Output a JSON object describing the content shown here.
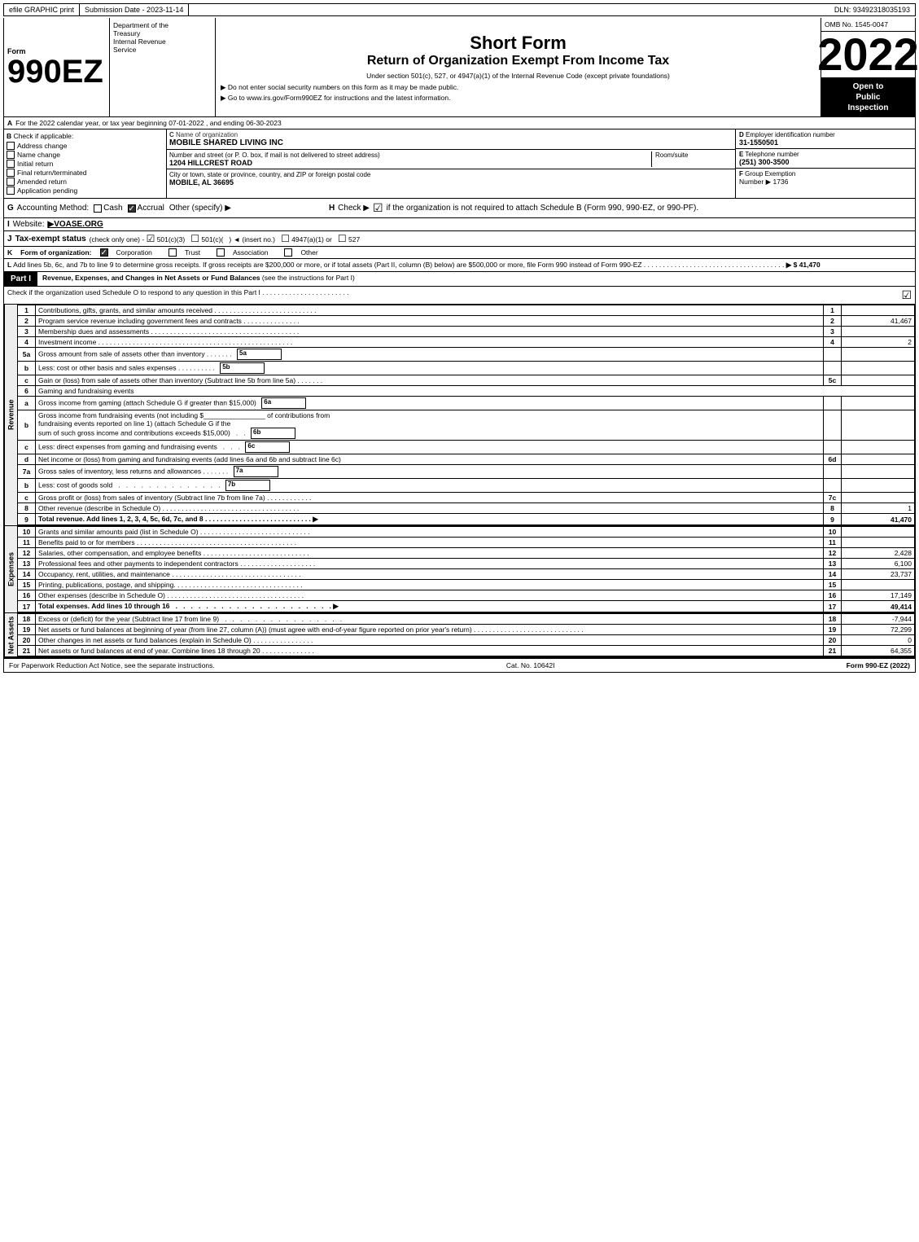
{
  "topBar": {
    "efile": "efile GRAPHIC print",
    "submissionLabel": "Submission Date - 2023-11-14",
    "dln": "DLN: 93492318035193"
  },
  "header": {
    "ombLabel": "OMB No. 1545-0047",
    "formNumber": "990EZ",
    "formDept1": "Department of the",
    "formDept2": "Treasury",
    "formDept3": "Internal Revenue",
    "formDept4": "Service",
    "shortForm": "Short Form",
    "returnTitle": "Return of Organization Exempt From Income Tax",
    "subtitle": "Under section 501(c), 527, or 4947(a)(1) of the Internal Revenue Code (except private foundations)",
    "inst1": "▶ Do not enter social security numbers on this form as it may be made public.",
    "inst2": "▶ Go to www.irs.gov/Form990EZ for instructions and the latest information.",
    "year": "2022",
    "openToPublic": "Open to\nPublic\nInspection"
  },
  "sectionA": {
    "label": "A",
    "text": "For the 2022 calendar year, or tax year beginning 07-01-2022 , and ending 06-30-2023"
  },
  "sectionB": {
    "label": "B",
    "title": "Check if applicable:",
    "options": [
      {
        "id": "address-change",
        "label": "Address change",
        "checked": false
      },
      {
        "id": "name-change",
        "label": "Name change",
        "checked": false
      },
      {
        "id": "initial-return",
        "label": "Initial return",
        "checked": false
      },
      {
        "id": "final-return",
        "label": "Final return/terminated",
        "checked": false
      },
      {
        "id": "amended-return",
        "label": "Amended return",
        "checked": false
      },
      {
        "id": "application-pending",
        "label": "Application pending",
        "checked": false
      }
    ]
  },
  "sectionC": {
    "label": "C",
    "title": "Name of organization",
    "orgName": "MOBILE SHARED LIVING INC",
    "addressLabel": "Number and street (or P. O. box, if mail is not delivered to street address)",
    "address": "1204 HILLCREST ROAD",
    "roomSuiteLabel": "Room/suite",
    "roomSuite": "",
    "cityLabel": "City or town, state or province, country, and ZIP or foreign postal code",
    "city": "MOBILE, AL  36695"
  },
  "sectionD": {
    "label": "D",
    "title": "Employer identification number",
    "ein": "31-1550501"
  },
  "sectionE": {
    "label": "E",
    "title": "Telephone number",
    "phone": "(251) 300-3500"
  },
  "sectionF": {
    "label": "F",
    "title": "Group Exemption",
    "numberLabel": "Number",
    "number": "▶ 1736"
  },
  "sectionG": {
    "label": "G",
    "title": "Accounting Method:",
    "cash": "Cash",
    "accrual": "Accrual",
    "accrualChecked": true,
    "other": "Other (specify) ▶",
    "otherValue": ""
  },
  "sectionH": {
    "label": "H",
    "text": "Check ▶",
    "checkLabel": "☑",
    "desc": "if the organization is not required to attach Schedule B (Form 990, 990-EZ, or 990-PF)."
  },
  "sectionI": {
    "label": "I",
    "title": "Website:",
    "url": "▶VOASE.ORG"
  },
  "sectionJ": {
    "label": "J",
    "title": "Tax-exempt status",
    "text": "(check only one) - ☑ 501(c)(3)  ☐ 501(c)(   ) ◄ (insert no.)  ☐ 4947(a)(1) or  ☐ 527"
  },
  "sectionK": {
    "label": "K",
    "title": "Form of organization:",
    "options": [
      "Corporation",
      "Trust",
      "Association",
      "Other"
    ],
    "corpChecked": true
  },
  "sectionL": {
    "label": "L",
    "text": "Add lines 5b, 6c, and 7b to line 9 to determine gross receipts. If gross receipts are $200,000 or more, or if total assets (Part II, column (B) below) are $500,000 or more, file Form 990 instead of Form 990-EZ . . . . . . . . . . . . . . . . . . . . . . . . . . . . . . . . . . . .",
    "arrow": "▶",
    "value": "$ 41,470"
  },
  "partI": {
    "label": "Part I",
    "title": "Revenue, Expenses, and Changes in Net Assets or Fund Balances",
    "seeNote": "(see the instructions for Part I)",
    "checkNote": "Check if the organization used Schedule O to respond to any question in this Part I . . . . . . . . . . . . . . . . . . . . . . .",
    "checkValue": "☑",
    "lines": [
      {
        "num": "1",
        "desc": "Contributions, gifts, grants, and similar amounts received . . . . . . . . . . . . . . . . . . . . . . . . . . .",
        "ref": "",
        "value": ""
      },
      {
        "num": "2",
        "desc": "Program service revenue including government fees and contracts . . . . . . . . . . . . . . .",
        "ref": "",
        "value": "41,467"
      },
      {
        "num": "3",
        "desc": "Membership dues and assessments . . . . . . . . . . . . . . . . . . . . . . . . . . . . . . . . . . . . . . .",
        "ref": "",
        "value": ""
      },
      {
        "num": "4",
        "desc": "Investment income . . . . . . . . . . . . . . . . . . . . . . . . . . . . . . . . . . . . . . . . . . . . . . . . . . .",
        "ref": "",
        "value": "2"
      },
      {
        "num": "5a",
        "desc": "Gross amount from sale of assets other than inventory . . . . . . . .",
        "ref": "5a",
        "value": ""
      },
      {
        "num": "b",
        "desc": "Less: cost or other basis and sales expenses . . . . . . . . . . .",
        "ref": "5b",
        "value": ""
      },
      {
        "num": "c",
        "desc": "Gain or (loss) from sale of assets other than inventory (Subtract line 5b from line 5a) . . . . . . .",
        "ref": "5c",
        "value": ""
      },
      {
        "num": "6",
        "desc": "Gaming and fundraising events",
        "ref": "",
        "value": ""
      },
      {
        "num": "a",
        "desc": "Gross income from gaming (attach Schedule G if greater than $15,000)",
        "ref": "6a",
        "value": ""
      },
      {
        "num": "b",
        "desc": "Gross income from fundraising events (not including $________________ of contributions from fundraising events reported on line 1) (attach Schedule G if the sum of such gross income and contributions exceeds $15,000)  .  .",
        "ref": "6b",
        "value": ""
      },
      {
        "num": "c",
        "desc": "Less: direct expenses from gaming and fundraising events . . . .",
        "ref": "6c",
        "value": ""
      },
      {
        "num": "d",
        "desc": "Net income or (loss) from gaming and fundraising events (add lines 6a and 6b and subtract line 6c)",
        "ref": "6d",
        "value": ""
      },
      {
        "num": "7a",
        "desc": "Gross sales of inventory, less returns and allowances . . . . . . .",
        "ref": "7a",
        "value": ""
      },
      {
        "num": "b",
        "desc": "Less: cost of goods sold . . . . . . . . . . . . . . . .",
        "ref": "7b",
        "value": ""
      },
      {
        "num": "c",
        "desc": "Gross profit or (loss) from sales of inventory (Subtract line 7b from line 7a) . . . . . . . . . . . .",
        "ref": "7c",
        "value": ""
      },
      {
        "num": "8",
        "desc": "Other revenue (describe in Schedule O) . . . . . . . . . . . . . . . . . . . . . . . . . . . . . . . . . . . .",
        "ref": "",
        "value": "1"
      },
      {
        "num": "9",
        "desc": "Total revenue. Add lines 1, 2, 3, 4, 5c, 6d, 7c, and 8 . . . . . . . . . . . . . . . . . . . . . . . . . . . .",
        "ref": "",
        "value": "41,470",
        "bold": true,
        "arrow": "▶"
      }
    ]
  },
  "partIExpenses": {
    "lines": [
      {
        "num": "10",
        "desc": "Grants and similar amounts paid (list in Schedule O) . . . . . . . . . . . . . . . . . . . . . . . . . . . . .",
        "value": ""
      },
      {
        "num": "11",
        "desc": "Benefits paid to or for members . . . . . . . . . . . . . . . . . . . . . . . . . . . . . . . . . . . . . . . . . .",
        "value": ""
      },
      {
        "num": "12",
        "desc": "Salaries, other compensation, and employee benefits . . . . . . . . . . . . . . . . . . . . . . . . . . . .",
        "value": "2,428"
      },
      {
        "num": "13",
        "desc": "Professional fees and other payments to independent contractors . . . . . . . . . . . . . . . . . . . .",
        "value": "6,100"
      },
      {
        "num": "14",
        "desc": "Occupancy, rent, utilities, and maintenance . . . . . . . . . . . . . . . . . . . . . . . . . . . . . . . . . .",
        "value": "23,737"
      },
      {
        "num": "15",
        "desc": "Printing, publications, postage, and shipping. . . . . . . . . . . . . . . . . . . . . . . . . . . . . . . . . .",
        "value": ""
      },
      {
        "num": "16",
        "desc": "Other expenses (describe in Schedule O) . . . . . . . . . . . . . . . . . . . . . . . . . . . . . . . . . . . .",
        "value": "17,149"
      },
      {
        "num": "17",
        "desc": "Total expenses. Add lines 10 through 16 . . . . . . . . . . . . . . . . . . . . . . . . . . . . . . . . . . . .",
        "value": "49,414",
        "bold": true,
        "arrow": "▶"
      }
    ]
  },
  "partINetAssets": {
    "lines": [
      {
        "num": "18",
        "desc": "Excess or (deficit) for the year (Subtract line 17 from line 9) . . . . . . . . . . . . . . . . . . . . . .",
        "value": "-7,944"
      },
      {
        "num": "19",
        "desc": "Net assets or fund balances at beginning of year (from line 27, column (A)) (must agree with end-of-year figure reported on prior year's return) . . . . . . . . . . . . . . . . . . . . . . . . . . . . .",
        "value": "72,299"
      },
      {
        "num": "20",
        "desc": "Other changes in net assets or fund balances (explain in Schedule O) . . . . . . . . . . . . . . . .",
        "value": "0"
      },
      {
        "num": "21",
        "desc": "Net assets or fund balances at end of year. Combine lines 18 through 20 . . . . . . . . . . . . . .",
        "value": "64,355"
      }
    ]
  },
  "footer": {
    "left": "For Paperwork Reduction Act Notice, see the separate instructions.",
    "catNo": "Cat. No. 10642I",
    "right": "Form 990-EZ (2022)"
  }
}
